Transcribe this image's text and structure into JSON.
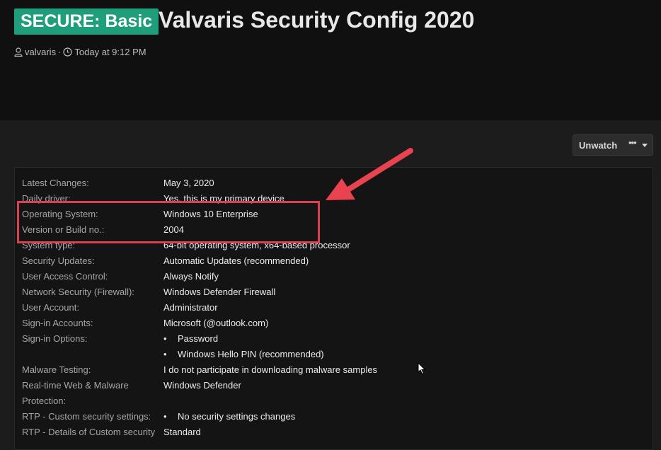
{
  "header": {
    "badge": "SECURE: Basic",
    "title": "Valvaris Security Config 2020",
    "author": "valvaris",
    "separator": "·",
    "time": "Today at 9:12 PM"
  },
  "actions": {
    "unwatch_label": "Unwatch",
    "more_label": "•••"
  },
  "config_rows": [
    {
      "label": "Latest Changes:",
      "value": "May 3, 2020"
    },
    {
      "label": "Daily driver:",
      "value": "Yes, this is my primary device"
    },
    {
      "label": "Operating System:",
      "value": "Windows 10 Enterprise"
    },
    {
      "label": "Version or Build no.:",
      "value": "2004"
    },
    {
      "label": "System type:",
      "value": "64-bit operating system, x64-based processor"
    },
    {
      "label": "Security Updates:",
      "value": "Automatic Updates (recommended)"
    },
    {
      "label": "User Access Control:",
      "value": "Always Notify"
    },
    {
      "label": "Network Security (Firewall):",
      "value": "Windows Defender Firewall"
    },
    {
      "label": "User Account:",
      "value": "Administrator"
    },
    {
      "label": "Sign-in Accounts:",
      "value": "Microsoft (@outlook.com)"
    },
    {
      "label": "Sign-in Options:",
      "value": "Password",
      "bullet": true
    },
    {
      "label": "",
      "value": "Windows Hello PIN (recommended)",
      "bullet": true
    },
    {
      "label": "Malware Testing:",
      "value": "I do not participate in downloading malware samples"
    },
    {
      "label": "Real-time Web & Malware",
      "value": "Windows Defender"
    },
    {
      "label": "Protection:",
      "value": ""
    },
    {
      "label": "RTP - Custom security settings:",
      "value": "No security settings changes",
      "bullet": true
    },
    {
      "label": "RTP - Details of Custom security",
      "value": "Standard"
    }
  ],
  "colors": {
    "badge": "#1f9e7c",
    "highlight": "#d94050"
  }
}
